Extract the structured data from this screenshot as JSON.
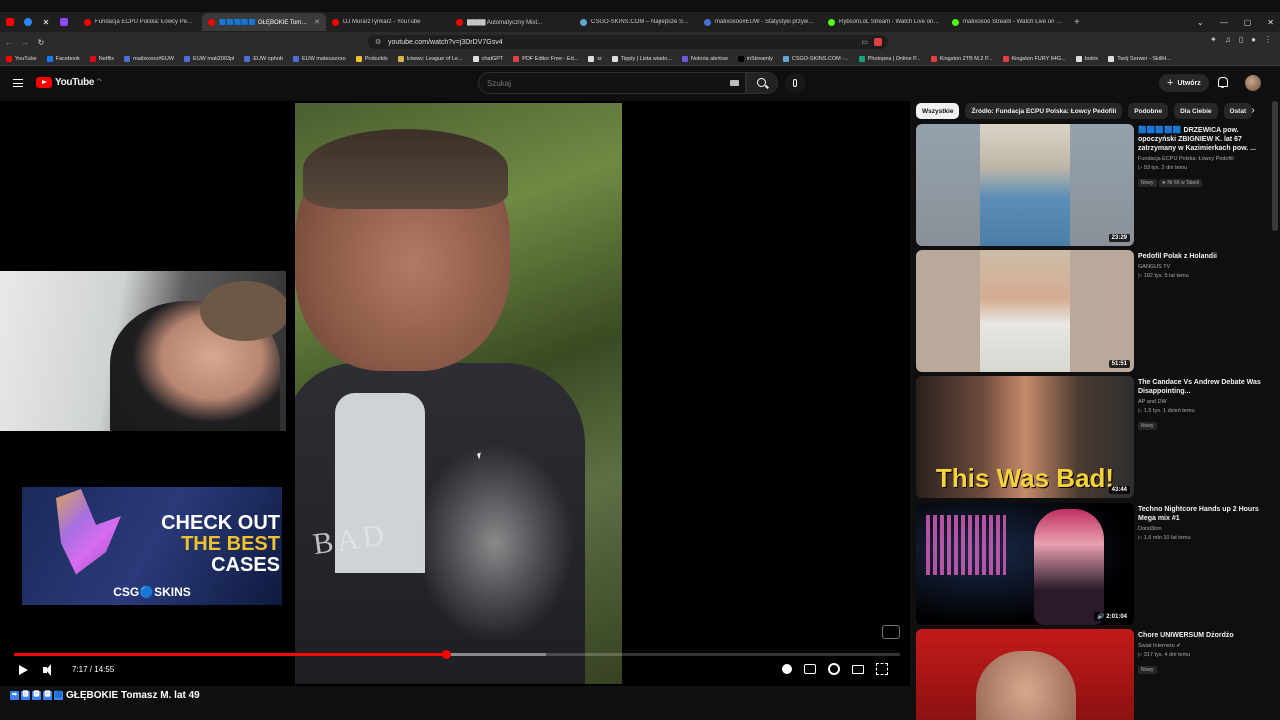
{
  "browser": {
    "tabs": [
      {
        "label": "Fundacja ECPU Polska: Łowcy Pedofili",
        "color": "#ff0000",
        "active": false
      },
      {
        "label": "🟦🟦🟦🟦🟦 GŁĘBOKIE Tomasz M. lat 49",
        "color": "#ff0000",
        "active": true
      },
      {
        "label": "DJ MurarzTynkarz - YouTube",
        "color": "#ff0000",
        "active": false
      },
      {
        "label": "▇▇▇▇ Automatyczny Mixt...",
        "color": "#ff0000",
        "active": false
      },
      {
        "label": "CSGO-SKINS.COM – Najlepsze Skrzy...",
        "color": "#5fa8d3",
        "active": false
      },
      {
        "label": "matixoxoo#EUW - Statystyki przywo...",
        "color": "#4a6fd8",
        "active": false
      },
      {
        "label": "RybsonLoL Stream - Watch Live on K...",
        "color": "#53fc18",
        "active": false
      },
      {
        "label": "matixoxoo Stream - Watch Live on K...",
        "color": "#53fc18",
        "active": false
      }
    ],
    "url": "youtube.com/watch?v=j3DrDV7Gsv4",
    "bookmarks": [
      {
        "label": "YouTube",
        "color": "#ff0000"
      },
      {
        "label": "Facebook",
        "color": "#1877f2"
      },
      {
        "label": "Netflix",
        "color": "#e50914"
      },
      {
        "label": "matixoxoo#EUW",
        "color": "#4a6fd8"
      },
      {
        "label": "EUW mati2003pl",
        "color": "#4a6fd8"
      },
      {
        "label": "EUW ophob",
        "color": "#4a6fd8"
      },
      {
        "label": "EUW mateuszxxo",
        "color": "#4a6fd8"
      },
      {
        "label": "Probuilds",
        "color": "#f0c12a"
      },
      {
        "label": "Iciwwv: League of Le...",
        "color": "#d8b24a"
      },
      {
        "label": "chatGPT",
        "color": "#dddddd"
      },
      {
        "label": "PDF Editor Free - Ed...",
        "color": "#e04040"
      },
      {
        "label": "sr",
        "color": "#dddddd"
      },
      {
        "label": "Tipply | Lista wiado...",
        "color": "#dddddd"
      },
      {
        "label": "Notoria alertow",
        "color": "#6a5ae0"
      },
      {
        "label": "inStreamly",
        "color": "#000000"
      },
      {
        "label": "CSGO-SKINS.COM -...",
        "color": "#5fa8d3"
      },
      {
        "label": "Photopea | Online P...",
        "color": "#1aa37a"
      },
      {
        "label": "Kingston 2TB M.2 P...",
        "color": "#e04040"
      },
      {
        "label": "Kingston FURY 64G...",
        "color": "#e04040"
      },
      {
        "label": "botrix",
        "color": "#dddddd"
      },
      {
        "label": "Twój Serwer - SkillH...",
        "color": "#dddddd"
      }
    ]
  },
  "youtube": {
    "logo_text": "YouTube",
    "country": "PL",
    "search_placeholder": "Szukaj",
    "create_label": "Utwórz"
  },
  "player": {
    "current_time": "7:17",
    "duration": "14:55",
    "time_label": "7:17 / 14:55",
    "progress_fraction": 0.488,
    "buffer_fraction": 0.6,
    "video_title": "GŁĘBOKIE Tomasz M. lat 49",
    "title_prefix_icons": [
      "➡",
      "🅱",
      "🅿",
      "🅿",
      "🟦"
    ],
    "hoodie_text": "BAD",
    "ad": {
      "line1": "CHECK OUT",
      "line2": "THE BEST",
      "line3": "CASES",
      "brand": "CSG🔵SKINS"
    }
  },
  "chips": [
    {
      "label": "Wszystkie",
      "active": true
    },
    {
      "label": "Źródło: Fundacja ECPU Polska: Łowcy Pedofili",
      "active": false
    },
    {
      "label": "Podobne",
      "active": false
    },
    {
      "label": "Dla Ciebie",
      "active": false
    },
    {
      "label": "Ostat",
      "active": false
    }
  ],
  "recommendations": [
    {
      "title": "🟦🟦🟦🟦🟦 DRZEWICA pow. opoczyński ZBIGNIEW K. lat 67 zatrzymany w Kazimierkach pow. ...",
      "channel": "Fundacja ECPU Polska: Łowcy Pedofili",
      "meta": "▷ 93 tys.   2 dni temu",
      "badges": [
        "Nowy",
        "★ Nr 66 w Tabeli"
      ],
      "duration": "23:29"
    },
    {
      "title": "Pedofil Polak z Holandii",
      "channel": "GANGUS TV",
      "meta": "▷ 182 tys.   5 lat temu",
      "badges": [],
      "duration": "51:51"
    },
    {
      "title": "The Candace Vs Andrew Debate Was Disappointing...",
      "channel": "AP and DW",
      "meta": "▷ 1,5 tys.   1 dzień temu",
      "badges": [
        "Nowy"
      ],
      "duration": "43:44",
      "thumb_text": "This Was Bad!"
    },
    {
      "title": "Techno Nightcore Hands up 2 Hours Mega mix #1",
      "channel": "Dorst3inn",
      "meta": "▷ 1,6 mln   10 lat temu",
      "badges": [],
      "duration": "🔊 2:01:04"
    },
    {
      "title": "Chore UNIWERSUM Dżordżo",
      "channel": "Świat Internetu ✔",
      "meta": "▷ 317 tys.   4 dni temu",
      "badges": [
        "Nowy"
      ],
      "duration": ""
    }
  ]
}
